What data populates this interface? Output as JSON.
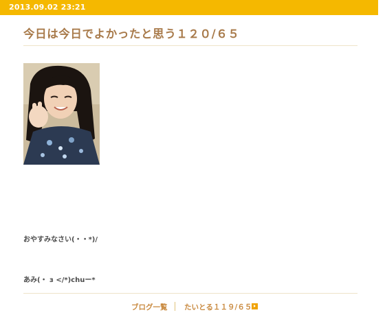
{
  "entry": {
    "date": "2013.09.02 23:21",
    "title": "今日は今日でよかったと思う１２０/６５",
    "body_lines": [
      "おやすみなさい(・・*)/",
      "あみ(・ з </*)chuー*"
    ],
    "photo_icon": "photo-image"
  },
  "navigation": {
    "blog_list_label": "ブログ一覧",
    "prev_entry_label": "たいとる１１９/６５",
    "arrow_icon": "arrow-right-icon"
  },
  "colors": {
    "accent": "#f5b800",
    "title": "#a87a4a",
    "link": "#c98a40",
    "text": "#4a4a4a"
  }
}
